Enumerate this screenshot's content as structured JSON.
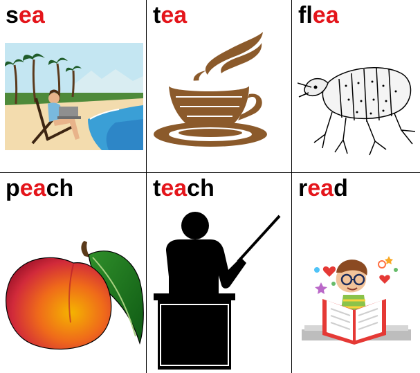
{
  "cards": [
    {
      "word": "sea",
      "parts": [
        {
          "t": "s",
          "hl": false
        },
        {
          "t": "ea",
          "hl": true
        }
      ],
      "picture": "beach-illustration"
    },
    {
      "word": "tea",
      "parts": [
        {
          "t": "t",
          "hl": false
        },
        {
          "t": "ea",
          "hl": true
        }
      ],
      "picture": "teacup-illustration"
    },
    {
      "word": "flea",
      "parts": [
        {
          "t": "fl",
          "hl": false
        },
        {
          "t": "ea",
          "hl": true
        }
      ],
      "picture": "flea-illustration"
    },
    {
      "word": "peach",
      "parts": [
        {
          "t": "p",
          "hl": false
        },
        {
          "t": "ea",
          "hl": true
        },
        {
          "t": "ch",
          "hl": false
        }
      ],
      "picture": "peach-illustration"
    },
    {
      "word": "teach",
      "parts": [
        {
          "t": "t",
          "hl": false
        },
        {
          "t": "ea",
          "hl": true
        },
        {
          "t": "ch",
          "hl": false
        }
      ],
      "picture": "teacher-illustration"
    },
    {
      "word": "read",
      "parts": [
        {
          "t": "r",
          "hl": false
        },
        {
          "t": "ea",
          "hl": true
        },
        {
          "t": "d",
          "hl": false
        }
      ],
      "picture": "reading-child-illustration"
    }
  ],
  "colors": {
    "highlight": "#e4151b",
    "text": "#000000",
    "cup": "#8b5a2b"
  }
}
